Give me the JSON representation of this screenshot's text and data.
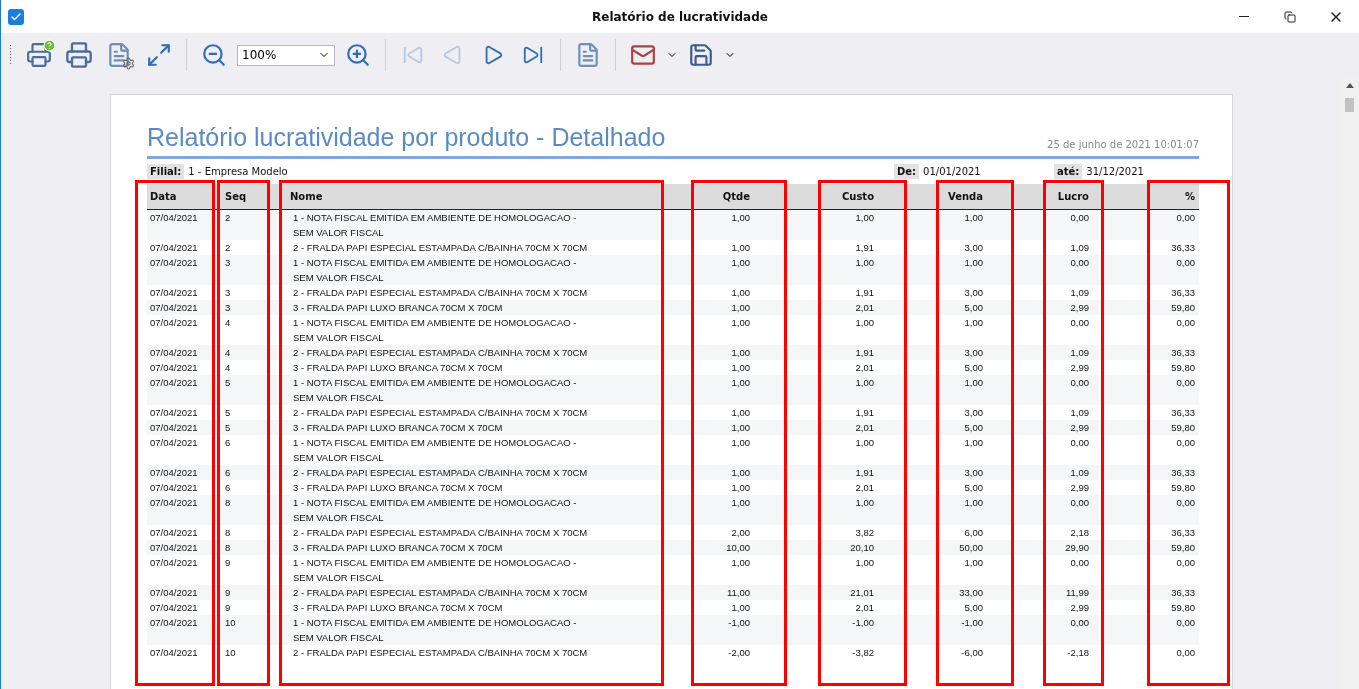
{
  "window": {
    "title": "Relatório de lucratividade"
  },
  "toolbar": {
    "zoom": "100%",
    "navigation": [
      {
        "disabled": true
      },
      {
        "disabled": true
      },
      {
        "disabled": false
      },
      {
        "disabled": false
      }
    ]
  },
  "report": {
    "title": "Relatório lucratividade por produto - Detalhado",
    "timestamp": "25 de junho de 2021 10:01:07",
    "filters": [
      {
        "label": "Filial:",
        "value": "1 - Empresa Modelo"
      },
      {
        "label": "De:",
        "value": "01/01/2021"
      },
      {
        "label": "até:",
        "value": "31/12/2021"
      }
    ],
    "columns": [
      {
        "label": "Data",
        "kind": "text",
        "highlighted": true
      },
      {
        "label": "Seq",
        "kind": "text",
        "highlighted": true
      },
      {
        "label": "Nome",
        "kind": "text",
        "highlighted": true
      },
      {
        "label": "Qtde",
        "kind": "number",
        "highlighted": true
      },
      {
        "label": "Custo",
        "kind": "number",
        "highlighted": true
      },
      {
        "label": "Venda",
        "kind": "number",
        "highlighted": true
      },
      {
        "label": "Lucro",
        "kind": "number",
        "highlighted": true
      },
      {
        "label": "%",
        "kind": "number",
        "highlighted": true
      }
    ],
    "rows": [
      [
        "07/04/2021",
        "2",
        "1 - NOTA FISCAL EMITIDA EM AMBIENTE DE HOMOLOGACAO -\nSEM VALOR FISCAL",
        "1,00",
        "1,00",
        "1,00",
        "0,00",
        "0,00"
      ],
      [
        "07/04/2021",
        "2",
        "2 - FRALDA PAPI ESPECIAL ESTAMPADA C/BAINHA 70CM X 70CM",
        "1,00",
        "1,91",
        "3,00",
        "1,09",
        "36,33"
      ],
      [
        "07/04/2021",
        "3",
        "1 - NOTA FISCAL EMITIDA EM AMBIENTE DE HOMOLOGACAO -\nSEM VALOR FISCAL",
        "1,00",
        "1,00",
        "1,00",
        "0,00",
        "0,00"
      ],
      [
        "07/04/2021",
        "3",
        "2 - FRALDA PAPI ESPECIAL ESTAMPADA C/BAINHA 70CM X 70CM",
        "1,00",
        "1,91",
        "3,00",
        "1,09",
        "36,33"
      ],
      [
        "07/04/2021",
        "3",
        "3 - FRALDA PAPI LUXO BRANCA 70CM X 70CM",
        "1,00",
        "2,01",
        "5,00",
        "2,99",
        "59,80"
      ],
      [
        "07/04/2021",
        "4",
        "1 - NOTA FISCAL EMITIDA EM AMBIENTE DE HOMOLOGACAO -\nSEM VALOR FISCAL",
        "1,00",
        "1,00",
        "1,00",
        "0,00",
        "0,00"
      ],
      [
        "07/04/2021",
        "4",
        "2 - FRALDA PAPI ESPECIAL ESTAMPADA C/BAINHA 70CM X 70CM",
        "1,00",
        "1,91",
        "3,00",
        "1,09",
        "36,33"
      ],
      [
        "07/04/2021",
        "4",
        "3 - FRALDA PAPI LUXO BRANCA 70CM X 70CM",
        "1,00",
        "2,01",
        "5,00",
        "2,99",
        "59,80"
      ],
      [
        "07/04/2021",
        "5",
        "1 - NOTA FISCAL EMITIDA EM AMBIENTE DE HOMOLOGACAO -\nSEM VALOR FISCAL",
        "1,00",
        "1,00",
        "1,00",
        "0,00",
        "0,00"
      ],
      [
        "07/04/2021",
        "5",
        "2 - FRALDA PAPI ESPECIAL ESTAMPADA C/BAINHA 70CM X 70CM",
        "1,00",
        "1,91",
        "3,00",
        "1,09",
        "36,33"
      ],
      [
        "07/04/2021",
        "5",
        "3 - FRALDA PAPI LUXO BRANCA 70CM X 70CM",
        "1,00",
        "2,01",
        "5,00",
        "2,99",
        "59,80"
      ],
      [
        "07/04/2021",
        "6",
        "1 - NOTA FISCAL EMITIDA EM AMBIENTE DE HOMOLOGACAO -\nSEM VALOR FISCAL",
        "1,00",
        "1,00",
        "1,00",
        "0,00",
        "0,00"
      ],
      [
        "07/04/2021",
        "6",
        "2 - FRALDA PAPI ESPECIAL ESTAMPADA C/BAINHA 70CM X 70CM",
        "1,00",
        "1,91",
        "3,00",
        "1,09",
        "36,33"
      ],
      [
        "07/04/2021",
        "6",
        "3 - FRALDA PAPI LUXO BRANCA 70CM X 70CM",
        "1,00",
        "2,01",
        "5,00",
        "2,99",
        "59,80"
      ],
      [
        "07/04/2021",
        "8",
        "1 - NOTA FISCAL EMITIDA EM AMBIENTE DE HOMOLOGACAO -\nSEM VALOR FISCAL",
        "1,00",
        "1,00",
        "1,00",
        "0,00",
        "0,00"
      ],
      [
        "07/04/2021",
        "8",
        "2 - FRALDA PAPI ESPECIAL ESTAMPADA C/BAINHA 70CM X 70CM",
        "2,00",
        "3,82",
        "6,00",
        "2,18",
        "36,33"
      ],
      [
        "07/04/2021",
        "8",
        "3 - FRALDA PAPI LUXO BRANCA 70CM X 70CM",
        "10,00",
        "20,10",
        "50,00",
        "29,90",
        "59,80"
      ],
      [
        "07/04/2021",
        "9",
        "1 - NOTA FISCAL EMITIDA EM AMBIENTE DE HOMOLOGACAO -\nSEM VALOR FISCAL",
        "1,00",
        "1,00",
        "1,00",
        "0,00",
        "0,00"
      ],
      [
        "07/04/2021",
        "9",
        "2 - FRALDA PAPI ESPECIAL ESTAMPADA C/BAINHA 70CM X 70CM",
        "11,00",
        "21,01",
        "33,00",
        "11,99",
        "36,33"
      ],
      [
        "07/04/2021",
        "9",
        "3 - FRALDA PAPI LUXO BRANCA 70CM X 70CM",
        "1,00",
        "2,01",
        "5,00",
        "2,99",
        "59,80"
      ],
      [
        "07/04/2021",
        "10",
        "1 - NOTA FISCAL EMITIDA EM AMBIENTE DE HOMOLOGACAO -\nSEM VALOR FISCAL",
        "-1,00",
        "-1,00",
        "-1,00",
        "0,00",
        "0,00"
      ],
      [
        "07/04/2021",
        "10",
        "2 - FRALDA PAPI ESPECIAL ESTAMPADA C/BAINHA 70CM X 70CM",
        "-2,00",
        "-3,82",
        "-6,00",
        "-2,18",
        "0,00"
      ]
    ]
  }
}
